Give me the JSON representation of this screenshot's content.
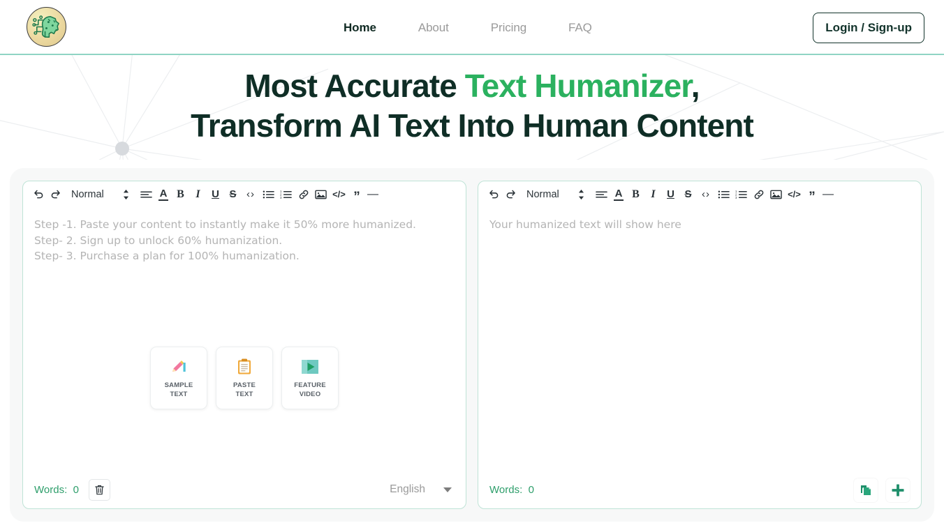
{
  "nav": {
    "logo_name": "ai-brain-circuit-logo",
    "links": [
      {
        "label": "Home",
        "active": true
      },
      {
        "label": "About",
        "active": false
      },
      {
        "label": "Pricing",
        "active": false
      },
      {
        "label": "FAQ",
        "active": false
      }
    ],
    "login_label": "Login / Sign-up"
  },
  "hero": {
    "line1_pre": "Most Accurate ",
    "line1_green": "Text Humanizer",
    "line1_post": ",",
    "line2": "Transform AI Text Into Human Content"
  },
  "toolbar": {
    "undo": "undo-icon",
    "redo": "redo-icon",
    "format": "Normal",
    "updown": "stepper-icon",
    "align": "align-icon",
    "font_color": "A",
    "bold": "B",
    "italic": "I",
    "underline": "U",
    "strike": "S",
    "angle": "‹›",
    "bullet_list": "bullet-list-icon",
    "numbered_list": "numbered-list-icon",
    "link": "link-icon",
    "image": "image-icon",
    "code": "</>",
    "quote": "”",
    "rule": "—"
  },
  "input_editor": {
    "placeholder": "Step -1. Paste your content to instantly make it 50% more humanized.\nStep- 2. Sign up to unlock 60% humanization.\nStep- 3. Purchase a plan for 100% humanization.",
    "cards": [
      {
        "label": "SAMPLE\nTEXT",
        "icon": "pencil-icon"
      },
      {
        "label": "PASTE\nTEXT",
        "icon": "clipboard-icon"
      },
      {
        "label": "FEATURE\nVIDEO",
        "icon": "play-video-icon"
      }
    ],
    "words_label": "Words:  ",
    "words_count": "0",
    "trash": "trash-icon",
    "language": "English"
  },
  "output_editor": {
    "placeholder": "Your humanized text will show here",
    "words_label": "Words:  ",
    "words_count": "0",
    "copy": "copy-icon",
    "add": "plus-icon"
  },
  "colors": {
    "accent_green": "#2bb15f",
    "dark_navy": "#0f2e26",
    "words_green": "#2e9e6b",
    "editor_border": "#bfe3d6",
    "panel_bg": "#f7f8f8",
    "placeholder_gray": "#b4b4b4"
  }
}
